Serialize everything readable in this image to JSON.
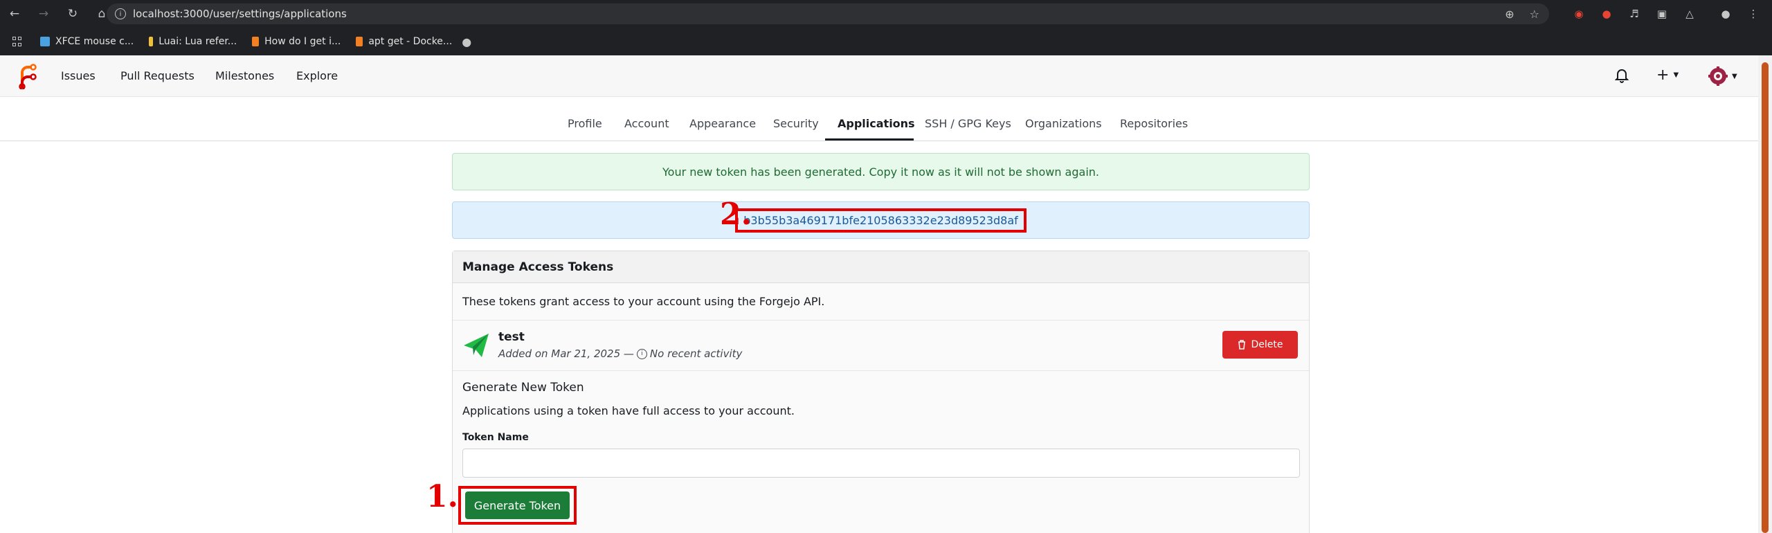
{
  "browser": {
    "url": "localhost:3000/user/settings/applications",
    "bookmarks": [
      {
        "label": "XFCE mouse c...",
        "color": "#4aa3df"
      },
      {
        "label": "Luai: Lua refer...",
        "color": "#f2c037"
      },
      {
        "label": "How do I get i...",
        "color": "#f48024"
      },
      {
        "label": "apt get - Docke...",
        "color": "#f48024"
      }
    ]
  },
  "navbar": {
    "items": [
      "Issues",
      "Pull Requests",
      "Milestones",
      "Explore"
    ],
    "plus_label": "+"
  },
  "tabs": [
    "Profile",
    "Account",
    "Appearance",
    "Security",
    "Applications",
    "SSH / GPG Keys",
    "Organizations",
    "Repositories"
  ],
  "flash": {
    "success": "Your new token has been generated. Copy it now as it will not be shown again.",
    "token": "b3b55b3a469171bfe2105863332e23d89523d8af"
  },
  "annotations": {
    "marker_1": "1.",
    "marker_2": "2."
  },
  "tokens_panel": {
    "title": "Manage Access Tokens",
    "description": "These tokens grant access to your account using the Forgejo API.",
    "tokens": [
      {
        "name": "test",
        "added": "Added on Mar 21, 2025 —",
        "activity": "No recent activity"
      }
    ],
    "delete_label": "Delete",
    "generate_title": "Generate New Token",
    "generate_desc": "Applications using a token have full access to your account.",
    "token_name_label": "Token Name",
    "token_name_value": "",
    "generate_button": "Generate Token"
  },
  "colors": {
    "primary_green": "#1c7d38",
    "danger_red": "#db2828",
    "annotation_red": "#e30000",
    "forgejo_orange": "#ff6600"
  }
}
